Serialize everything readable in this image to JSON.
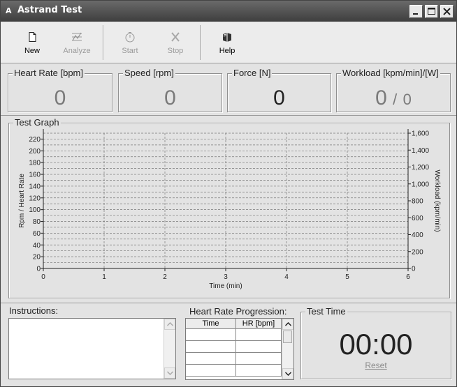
{
  "window": {
    "title": "Astrand Test"
  },
  "toolbar": {
    "items": [
      {
        "label": "New",
        "icon": "new-document-icon",
        "enabled": true
      },
      {
        "label": "Analyze",
        "icon": "analyze-icon",
        "enabled": false
      },
      {
        "label": "Start",
        "icon": "stopwatch-icon",
        "enabled": false
      },
      {
        "label": "Stop",
        "icon": "stop-x-icon",
        "enabled": false
      },
      {
        "label": "Help",
        "icon": "help-book-icon",
        "enabled": true
      }
    ]
  },
  "metrics": {
    "heart_rate": {
      "label": "Heart Rate [bpm]",
      "value": "0"
    },
    "speed": {
      "label": "Speed [rpm]",
      "value": "0"
    },
    "force": {
      "label": "Force [N]",
      "value": "0"
    },
    "workload": {
      "label": "Workload [kpm/min]/[W]",
      "value": "0",
      "separator": "/",
      "value2": "0"
    }
  },
  "graph": {
    "group_label": "Test Graph"
  },
  "chart_data": {
    "type": "line",
    "xlabel": "Time (min)",
    "ylabel": "Rpm / Heart Rate",
    "y2label": "Workload (kpm/min)",
    "xlim": [
      0,
      6
    ],
    "ylim": [
      0,
      230
    ],
    "y2lim": [
      0,
      1600
    ],
    "x_ticks": [
      "0",
      "1",
      "2",
      "3",
      "4",
      "5",
      "6"
    ],
    "y_ticks": [
      "0",
      "20",
      "40",
      "60",
      "80",
      "100",
      "120",
      "140",
      "160",
      "180",
      "200",
      "220"
    ],
    "y2_ticks": [
      "0",
      "200",
      "400",
      "600",
      "800",
      "1,000",
      "1,200",
      "1,400",
      "1,600"
    ],
    "grid": true,
    "series": []
  },
  "instructions": {
    "label": "Instructions:",
    "text": ""
  },
  "hr_progression": {
    "label": "Heart Rate Progression:",
    "columns": [
      "Time",
      "HR [bpm]"
    ],
    "rows": []
  },
  "test_time": {
    "label": "Test Time",
    "value": "00:00",
    "reset_label": "Reset"
  }
}
